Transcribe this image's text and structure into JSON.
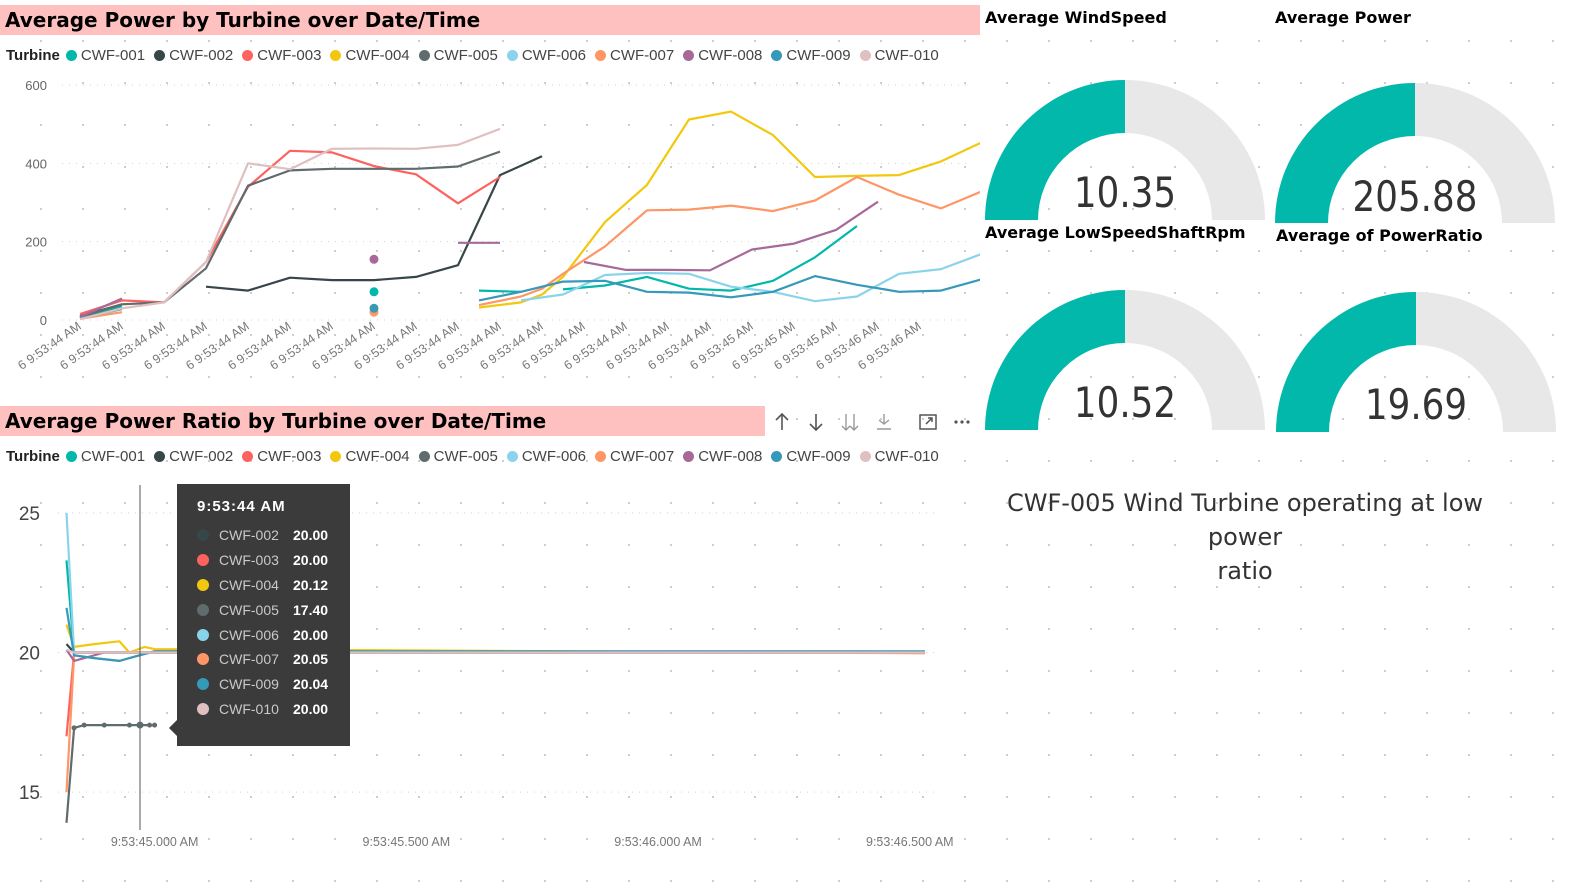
{
  "turbine_colors": {
    "CWF-001": "#01b8aa",
    "CWF-002": "#374649",
    "CWF-003": "#fd625e",
    "CWF-004": "#f2c80f",
    "CWF-005": "#5f6b6d",
    "CWF-006": "#8ad4eb",
    "CWF-007": "#fe9666",
    "CWF-008": "#a66999",
    "CWF-009": "#3599b8",
    "CWF-010": "#dfbfbf"
  },
  "power_chart": {
    "title": "Average Power by Turbine over Date/Time",
    "legend_title": "Turbine",
    "legend": [
      "CWF-001",
      "CWF-002",
      "CWF-003",
      "CWF-004",
      "CWF-005",
      "CWF-006",
      "CWF-007",
      "CWF-008",
      "CWF-009",
      "CWF-010"
    ],
    "y_ticks": [
      "600",
      "400",
      "200",
      "0"
    ],
    "x_ticks": [
      "6 9:53:44 AM",
      "6 9:53:44 AM",
      "6 9:53:44 AM",
      "6 9:53:44 AM",
      "6 9:53:44 AM",
      "6 9:53:44 AM",
      "6 9:53:44 AM",
      "6 9:53:44 AM",
      "6 9:53:44 AM",
      "6 9:53:44 AM",
      "6 9:53:44 AM",
      "6 9:53:44 AM",
      "6 9:53:44 AM",
      "6 9:53:44 AM",
      "6 9:53:44 AM",
      "6 9:53:44 AM",
      "6 9:53:45 AM",
      "6 9:53:45 AM",
      "6 9:53:45 AM",
      "6 9:53:46 AM",
      "6 9:53:46 AM"
    ]
  },
  "ratio_chart": {
    "title": "Average Power Ratio by Turbine over Date/Time",
    "legend_title": "Turbine",
    "legend": [
      "CWF-001",
      "CWF-002",
      "CWF-003",
      "CWF-004",
      "CWF-005",
      "CWF-006",
      "CWF-007",
      "CWF-008",
      "CWF-009",
      "CWF-010"
    ],
    "y_ticks": [
      "25",
      "20",
      "15"
    ],
    "x_ticks": [
      "9:53:45.000 AM",
      "9:53:45.500 AM",
      "9:53:46.000 AM",
      "9:53:46.500 AM"
    ]
  },
  "tooltip": {
    "title": "9:53:44 AM",
    "rows": [
      {
        "name": "CWF-002",
        "value": "20.00",
        "color": "#374649"
      },
      {
        "name": "CWF-003",
        "value": "20.00",
        "color": "#fd625e"
      },
      {
        "name": "CWF-004",
        "value": "20.12",
        "color": "#f2c80f"
      },
      {
        "name": "CWF-005",
        "value": "17.40",
        "color": "#5f6b6d"
      },
      {
        "name": "CWF-006",
        "value": "20.00",
        "color": "#8ad4eb"
      },
      {
        "name": "CWF-007",
        "value": "20.05",
        "color": "#fe9666"
      },
      {
        "name": "CWF-009",
        "value": "20.04",
        "color": "#3599b8"
      },
      {
        "name": "CWF-010",
        "value": "20.00",
        "color": "#dfbfbf"
      }
    ]
  },
  "toolbar_icons": [
    "sort-ascending-icon",
    "sort-descending-icon",
    "drill-all-icon",
    "expand-hierarchy-icon",
    "focus-mode-icon",
    "more-options-icon"
  ],
  "gauges": {
    "windspeed": {
      "title": "Average WindSpeed",
      "value": "10.35",
      "fraction": 0.5
    },
    "power": {
      "title": "Average Power",
      "value": "205.88",
      "fraction": 0.5
    },
    "lowspeed": {
      "title": "Average LowSpeedShaftRpm",
      "value": "10.52",
      "fraction": 0.5
    },
    "powerratio": {
      "title": "Average of PowerRatio",
      "value": "19.69",
      "fraction": 0.5
    },
    "fill_color": "#01b8aa",
    "track_color": "#e8e8e8"
  },
  "alert_text": {
    "line1": "CWF-005 Wind Turbine operating at low power",
    "line2": "ratio"
  },
  "chart_data": [
    {
      "type": "line",
      "title": "Average Power by Turbine over Date/Time",
      "xlabel": "",
      "ylabel": "",
      "ylim": [
        0,
        600
      ],
      "x_labels": [
        "6 9:53:44 AM",
        "6 9:53:44 AM",
        "6 9:53:44 AM",
        "6 9:53:44 AM",
        "6 9:53:44 AM",
        "6 9:53:44 AM",
        "6 9:53:44 AM",
        "6 9:53:44 AM",
        "6 9:53:44 AM",
        "6 9:53:44 AM",
        "6 9:53:44 AM",
        "6 9:53:44 AM",
        "6 9:53:44 AM",
        "6 9:53:44 AM",
        "6 9:53:44 AM",
        "6 9:53:44 AM",
        "6 9:53:45 AM",
        "6 9:53:45 AM",
        "6 9:53:45 AM",
        "6 9:53:46 AM",
        "6 9:53:46 AM"
      ],
      "series": [
        {
          "name": "CWF-001",
          "segments": [
            [
              [
                0,
                5
              ],
              [
                1,
                35
              ]
            ],
            [
              [
                7,
                72
              ]
            ],
            [
              [
                9.5,
                75
              ],
              [
                10.5,
                72
              ]
            ],
            [
              [
                11.5,
                78
              ],
              [
                12.5,
                88
              ],
              [
                13.5,
                110
              ],
              [
                14.5,
                80
              ],
              [
                15.5,
                75
              ],
              [
                16.5,
                100
              ],
              [
                17.5,
                160
              ],
              [
                18.5,
                240
              ]
            ]
          ]
        },
        {
          "name": "CWF-002",
          "segments": [
            [
              [
                0,
                10
              ],
              [
                1,
                40
              ]
            ],
            [
              [
                3,
                85
              ],
              [
                4,
                75
              ],
              [
                5,
                108
              ],
              [
                6,
                102
              ],
              [
                7,
                102
              ],
              [
                8,
                110
              ],
              [
                9,
                140
              ],
              [
                10,
                370
              ],
              [
                11,
                418
              ]
            ]
          ]
        },
        {
          "name": "CWF-003",
          "segments": [
            [
              [
                0,
                15
              ],
              [
                1,
                50
              ],
              [
                2,
                45
              ],
              [
                3,
                148
              ],
              [
                4,
                340
              ],
              [
                5,
                432
              ],
              [
                6,
                428
              ],
              [
                7,
                393
              ],
              [
                8,
                372
              ],
              [
                9,
                298
              ],
              [
                10,
                365
              ]
            ]
          ]
        },
        {
          "name": "CWF-004",
          "segments": [
            [
              [
                9.5,
                32
              ],
              [
                10.5,
                45
              ],
              [
                11,
                65
              ],
              [
                11.5,
                110
              ],
              [
                12.5,
                250
              ],
              [
                13.5,
                345
              ],
              [
                14.5,
                512
              ],
              [
                15.5,
                532
              ],
              [
                16.5,
                472
              ],
              [
                17.5,
                365
              ],
              [
                18.5,
                368
              ],
              [
                19.5,
                370
              ],
              [
                20.5,
                405
              ],
              [
                21.5,
                455
              ]
            ]
          ]
        },
        {
          "name": "CWF-005",
          "segments": [
            [
              [
                0,
                8
              ],
              [
                1,
                40
              ],
              [
                2,
                45
              ],
              [
                3,
                132
              ],
              [
                4,
                343
              ],
              [
                5,
                382
              ],
              [
                6,
                386
              ],
              [
                7,
                386
              ],
              [
                8,
                386
              ],
              [
                9,
                392
              ],
              [
                10,
                430
              ]
            ]
          ]
        },
        {
          "name": "CWF-006",
          "segments": [
            [
              [
                10.5,
                50
              ],
              [
                11.5,
                65
              ],
              [
                12.5,
                115
              ],
              [
                13.5,
                120
              ],
              [
                14.5,
                118
              ],
              [
                15.5,
                85
              ],
              [
                16.5,
                72
              ],
              [
                17.5,
                48
              ],
              [
                18.5,
                60
              ],
              [
                19.5,
                118
              ],
              [
                20.5,
                130
              ],
              [
                21.5,
                170
              ],
              [
                22.5,
                222
              ]
            ]
          ]
        },
        {
          "name": "CWF-007",
          "segments": [
            [
              [
                0,
                3
              ],
              [
                1,
                20
              ]
            ],
            [
              [
                7,
                20
              ]
            ],
            [
              [
                9.5,
                38
              ],
              [
                10.5,
                60
              ],
              [
                11,
                80
              ],
              [
                11.5,
                118
              ],
              [
                12.5,
                188
              ],
              [
                13.5,
                280
              ],
              [
                14.5,
                282
              ],
              [
                15.5,
                292
              ],
              [
                16.5,
                278
              ],
              [
                17.5,
                305
              ],
              [
                18.5,
                365
              ],
              [
                19.5,
                320
              ],
              [
                20.5,
                285
              ],
              [
                21.5,
                330
              ],
              [
                22.5,
                407
              ]
            ]
          ]
        },
        {
          "name": "CWF-008",
          "segments": [
            [
              [
                0,
                8
              ],
              [
                1,
                55
              ]
            ],
            [
              [
                7,
                155
              ]
            ],
            [
              [
                9,
                197
              ],
              [
                10,
                197
              ]
            ],
            [
              [
                12,
                148
              ],
              [
                13,
                128
              ],
              [
                14,
                128
              ],
              [
                15,
                127
              ],
              [
                16,
                180
              ],
              [
                17,
                195
              ],
              [
                18,
                230
              ],
              [
                19,
                302
              ]
            ]
          ]
        },
        {
          "name": "CWF-009",
          "segments": [
            [
              [
                0,
                4
              ],
              [
                1,
                28
              ]
            ],
            [
              [
                7,
                30
              ]
            ],
            [
              [
                9.5,
                50
              ],
              [
                10.5,
                72
              ],
              [
                11.5,
                98
              ],
              [
                12.5,
                100
              ],
              [
                13.5,
                72
              ],
              [
                14.5,
                70
              ],
              [
                15.5,
                58
              ],
              [
                16.5,
                72
              ],
              [
                17.5,
                112
              ],
              [
                18.5,
                90
              ],
              [
                19.5,
                72
              ],
              [
                20.5,
                75
              ],
              [
                21.5,
                105
              ],
              [
                22.5,
                160
              ]
            ]
          ]
        },
        {
          "name": "CWF-010",
          "segments": [
            [
              [
                0,
                2
              ],
              [
                1,
                30
              ],
              [
                2,
                45
              ],
              [
                3,
                148
              ],
              [
                4,
                400
              ],
              [
                5,
                385
              ],
              [
                6,
                437
              ],
              [
                7,
                438
              ],
              [
                8,
                437
              ],
              [
                9,
                447
              ],
              [
                10,
                488
              ]
            ]
          ]
        }
      ]
    },
    {
      "type": "line",
      "title": "Average Power Ratio by Turbine over Date/Time",
      "xlabel": "",
      "ylabel": "",
      "ylim": [
        14,
        26
      ],
      "x_ticks": [
        "9:53:45.000 AM",
        "9:53:45.500 AM",
        "9:53:46.000 AM",
        "9:53:46.500 AM"
      ],
      "xlim_seconds_after_945": [
        -0.18,
        1.56
      ],
      "series": [
        {
          "name": "CWF-001",
          "points": [
            [
              -0.175,
              23.3
            ],
            [
              -0.16,
              20.0
            ],
            [
              1.53,
              20.0
            ]
          ]
        },
        {
          "name": "CWF-002",
          "points": [
            [
              -0.175,
              20.3
            ],
            [
              -0.16,
              20.0
            ],
            [
              -0.05,
              20.0
            ],
            [
              1.53,
              20.0
            ]
          ]
        },
        {
          "name": "CWF-003",
          "points": [
            [
              -0.175,
              17.0
            ],
            [
              -0.16,
              20.0
            ],
            [
              1.53,
              20.0
            ]
          ]
        },
        {
          "name": "CWF-004",
          "points": [
            [
              -0.175,
              21.0
            ],
            [
              -0.16,
              20.2
            ],
            [
              -0.12,
              20.3
            ],
            [
              -0.07,
              20.4
            ],
            [
              -0.05,
              20.0
            ],
            [
              -0.02,
              20.2
            ],
            [
              0.0,
              20.12
            ],
            [
              1.53,
              19.98
            ]
          ]
        },
        {
          "name": "CWF-005",
          "points": [
            [
              -0.175,
              13.9
            ],
            [
              -0.16,
              17.3
            ],
            [
              -0.14,
              17.4
            ],
            [
              -0.1,
              17.4
            ],
            [
              -0.05,
              17.4
            ],
            [
              -0.01,
              17.4
            ],
            [
              0.0,
              17.4
            ]
          ]
        },
        {
          "name": "CWF-006",
          "points": [
            [
              -0.175,
              25.0
            ],
            [
              -0.16,
              20.0
            ],
            [
              1.53,
              20.0
            ]
          ]
        },
        {
          "name": "CWF-007",
          "points": [
            [
              -0.175,
              15.0
            ],
            [
              -0.16,
              19.9
            ],
            [
              -0.12,
              19.8
            ],
            [
              -0.07,
              19.7
            ],
            [
              -0.03,
              19.9
            ],
            [
              0.0,
              20.05
            ],
            [
              1.53,
              19.98
            ]
          ]
        },
        {
          "name": "CWF-008",
          "points": [
            [
              -0.175,
              20.1
            ],
            [
              -0.16,
              19.7
            ],
            [
              -0.1,
              20.0
            ],
            [
              1.53,
              20.0
            ]
          ]
        },
        {
          "name": "CWF-009",
          "points": [
            [
              -0.175,
              21.6
            ],
            [
              -0.16,
              19.9
            ],
            [
              -0.12,
              19.8
            ],
            [
              -0.07,
              19.7
            ],
            [
              -0.03,
              19.9
            ],
            [
              0.0,
              20.04
            ],
            [
              1.53,
              20.04
            ]
          ]
        },
        {
          "name": "CWF-010",
          "points": [
            [
              -0.175,
              20.1
            ],
            [
              -0.16,
              20.0
            ],
            [
              1.53,
              20.0
            ]
          ]
        }
      ]
    }
  ]
}
